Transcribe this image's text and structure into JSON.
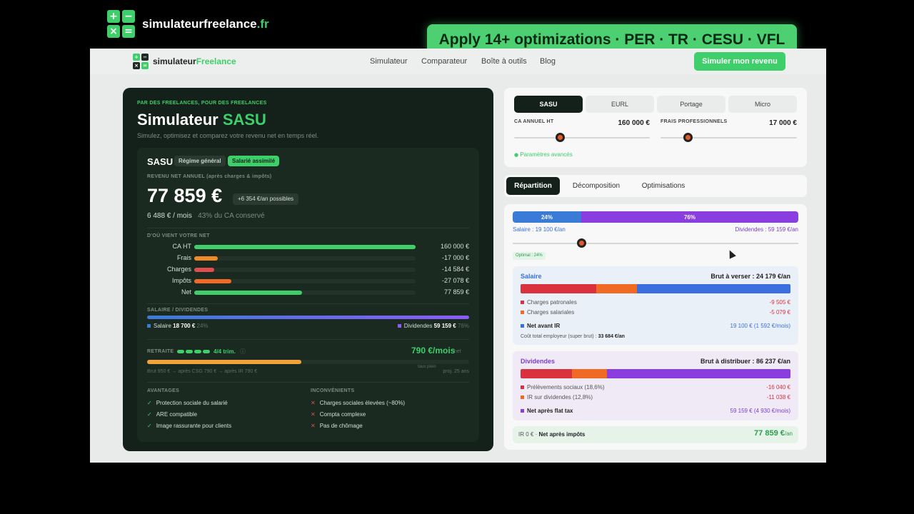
{
  "overlay": {
    "brand_name": "simulateurfreelance",
    "brand_tld": ".fr",
    "banner": "Apply 14+ optimizations · PER · TR · CESU · VFL",
    "logo_glyphs": [
      "+",
      "−",
      "×",
      "="
    ]
  },
  "nav": {
    "logo_main": "simulateur",
    "logo_accent": "Freelance",
    "links": [
      "Simulateur",
      "Comparateur",
      "Boîte à outils",
      "Blog"
    ],
    "cta": "Simuler mon revenu"
  },
  "hero": {
    "tagline": "PAR DES FREELANCES, POUR DES FREELANCES",
    "title_main": "Simulateur ",
    "title_accent": "SASU",
    "subtitle": "Simulez, optimisez et comparez votre revenu net en temps réel."
  },
  "result": {
    "status": "SASU",
    "badge_regime": "Régime général",
    "badge_salarie": "Salarié assimilé",
    "net_label": "REVENU NET ANNUEL (après charges & impôts)",
    "net_amount": "77 859 €",
    "net_possible": "+6 354 €/an possibles",
    "net_month": "6 488 € / mois",
    "net_share": "43% du CA conservé",
    "flow_title": "D'OÙ VIENT VOTRE NET",
    "flow": [
      {
        "label": "CA HT",
        "value": "160 000 €",
        "ratio": 1.0,
        "color": "#3ecf6a"
      },
      {
        "label": "Frais",
        "value": "-17 000 €",
        "ratio": 0.106,
        "color": "#f08a24"
      },
      {
        "label": "Charges",
        "value": "-14 584 €",
        "ratio": 0.091,
        "color": "#e04f4f"
      },
      {
        "label": "Impôts",
        "value": "-27 078 €",
        "ratio": 0.169,
        "color": "#f06a24"
      },
      {
        "label": "Net",
        "value": "77 859 €",
        "ratio": 0.487,
        "color": "#3ecf6a"
      }
    ],
    "split_title": "SALAIRE / DIVIDENDES",
    "split_salaire_label": "Salaire",
    "split_salaire_value": "18 700 €",
    "split_salaire_pct": "24%",
    "split_div_label": "Dividendes",
    "split_div_value": "59 159 €",
    "split_div_pct": "76%",
    "retraite_title": "RETRAITE",
    "retraite_trim": "4/4 trim.",
    "retraite_info": "ⓘ",
    "retraite_amount": "790 €/mois",
    "retraite_unit": "net",
    "retraite_ratio": 0.48,
    "retraite_note": "Brut 950 € → après CSG 790 € → après IR 790 €",
    "retraite_tick": "taux plein",
    "retraite_proj": "proj. 25 ans",
    "avantages_title": "AVANTAGES",
    "avantages": [
      "Protection sociale du salarié",
      "ARE compatible",
      "Image rassurante pour clients"
    ],
    "inconvenients_title": "INCONVÉNIENTS",
    "inconvenients": [
      "Charges sociales élevées (~80%)",
      "Compta complexe",
      "Pas de chômage"
    ]
  },
  "controls": {
    "status_tabs": [
      "SASU",
      "EURL",
      "Portage",
      "Micro"
    ],
    "active_status": "SASU",
    "ca_label": "CA ANNUEL HT",
    "ca_value": "160 000 €",
    "ca_level": 0.33,
    "frais_label": "FRAIS PROFESSIONNELS",
    "frais_value": "17 000 €",
    "frais_level": 0.2,
    "advanced": "Paramètres avancés"
  },
  "tabs": [
    "Répartition",
    "Décomposition",
    "Optimisations"
  ],
  "repartition": {
    "salaire_pct": "24%",
    "dividendes_pct": "76%",
    "salaire_legend": "Salaire : 19 100 €/an",
    "dividendes_legend": "Dividendes : 59 159 €/an",
    "optimal": "Optimal : 24%",
    "salaire_box": {
      "title": "Salaire",
      "brut": "Brut à verser : 24 179 €/an",
      "segments": [
        0.28,
        0.15,
        0.57
      ],
      "colors": [
        "#d9313e",
        "#f06a24",
        "#3b6fe0"
      ],
      "items": [
        {
          "label": "Charges patronales",
          "value": "-9 505 €",
          "color": "#d9313e"
        },
        {
          "label": "Charges salariales",
          "value": "-5 079 €",
          "color": "#f06a24"
        }
      ],
      "net_label": "Net avant IR",
      "net_value": "19 100 € (1 592 €/mois)",
      "cost_label": "Coût total employeur (super brut) : ",
      "cost_value": "33 684 €/an"
    },
    "dividendes_box": {
      "title": "Dividendes",
      "brut": "Brut à distribuer : 86 237 €/an",
      "segments": [
        0.19,
        0.13,
        0.68
      ],
      "colors": [
        "#d9313e",
        "#f06a24",
        "#8b3ee0"
      ],
      "items": [
        {
          "label": "Prélèvements sociaux (18,6%)",
          "value": "-16 040 €",
          "color": "#d9313e"
        },
        {
          "label": "IR sur dividendes (12,8%)",
          "value": "-11 038 €",
          "color": "#f06a24"
        }
      ],
      "net_label": "Net après flat tax",
      "net_value": "59 159 € (4 930 €/mois)"
    },
    "total": {
      "ir": "IR 0 €",
      "label": "Net après impôts",
      "value": "77 859 €",
      "unit": "/an"
    }
  }
}
